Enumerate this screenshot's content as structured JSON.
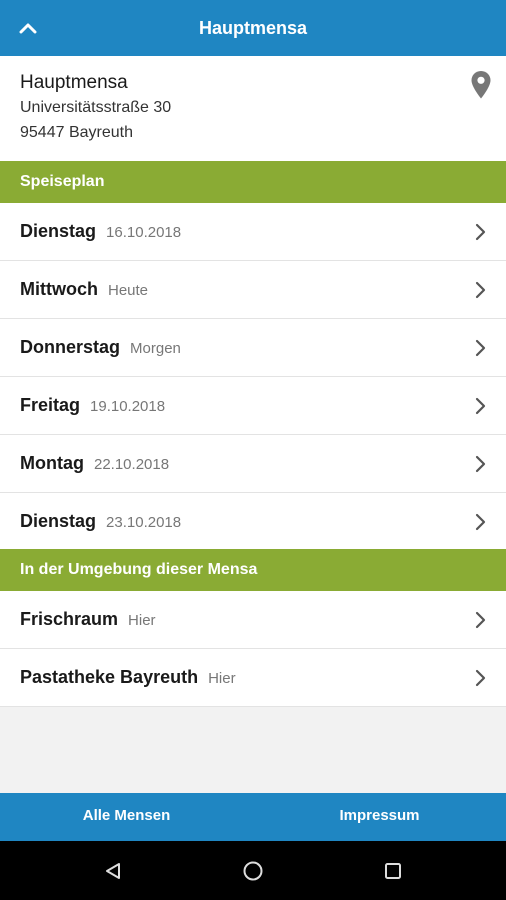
{
  "app": {
    "title": "Hauptmensa",
    "accent_color": "#1f86c2",
    "section_color": "#8aab34"
  },
  "mensa": {
    "name": "Hauptmensa",
    "address_line1": "Universitätsstraße 30",
    "address_line2": "95447 Bayreuth",
    "location_icon": "location-pin-icon"
  },
  "speiseplan": {
    "header": "Speiseplan",
    "days": [
      {
        "day": "Dienstag",
        "date": "16.10.2018"
      },
      {
        "day": "Mittwoch",
        "date": "Heute"
      },
      {
        "day": "Donnerstag",
        "date": "Morgen"
      },
      {
        "day": "Freitag",
        "date": "19.10.2018"
      },
      {
        "day": "Montag",
        "date": "22.10.2018"
      },
      {
        "day": "Dienstag",
        "date": "23.10.2018"
      }
    ]
  },
  "nearby": {
    "header": "In der Umgebung dieser Mensa",
    "items": [
      {
        "name": "Frischraum",
        "distance": "Hier"
      },
      {
        "name": "Pastatheke Bayreuth",
        "distance": "Hier"
      }
    ]
  },
  "footer": {
    "all_label": "Alle Mensen",
    "impressum_label": "Impressum"
  },
  "system_nav": {
    "back_icon": "back-triangle-icon",
    "home_icon": "home-circle-icon",
    "recents_icon": "recents-square-icon"
  }
}
